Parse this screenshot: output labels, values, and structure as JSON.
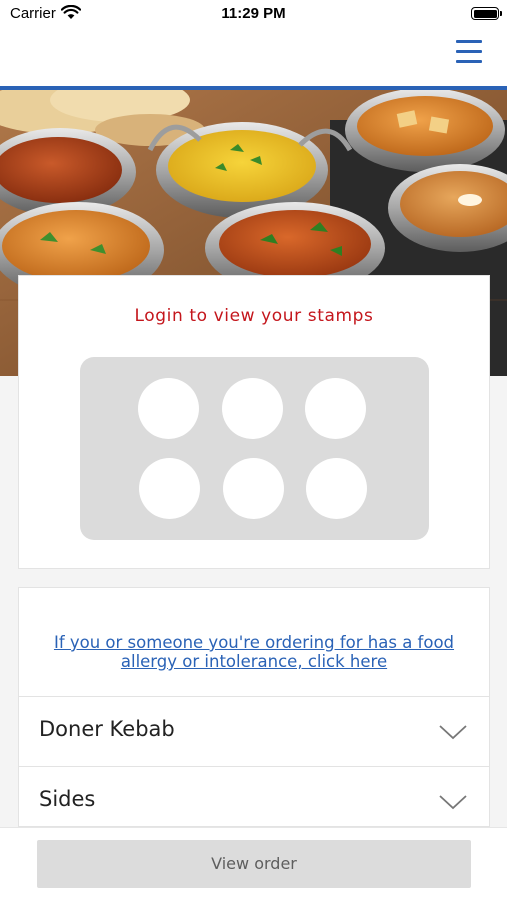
{
  "status_bar": {
    "carrier": "Carrier",
    "time": "11:29 PM"
  },
  "nav": {
    "menu_icon": "hamburger-menu-icon",
    "accent_color": "#2a62b6"
  },
  "hero": {
    "image": "indian-curry-dishes-photo"
  },
  "stamps": {
    "title": "Login to view your stamps",
    "count": 6,
    "title_color": "#c4161c"
  },
  "allergy": {
    "link_text": "If you or someone you're ordering for has a food allergy or intolerance, click here"
  },
  "menu_categories": [
    {
      "label": "Doner Kebab",
      "icon": "chevron-down-icon"
    },
    {
      "label": "Sides",
      "icon": "chevron-down-icon"
    }
  ],
  "footer": {
    "button_label": "View order"
  }
}
